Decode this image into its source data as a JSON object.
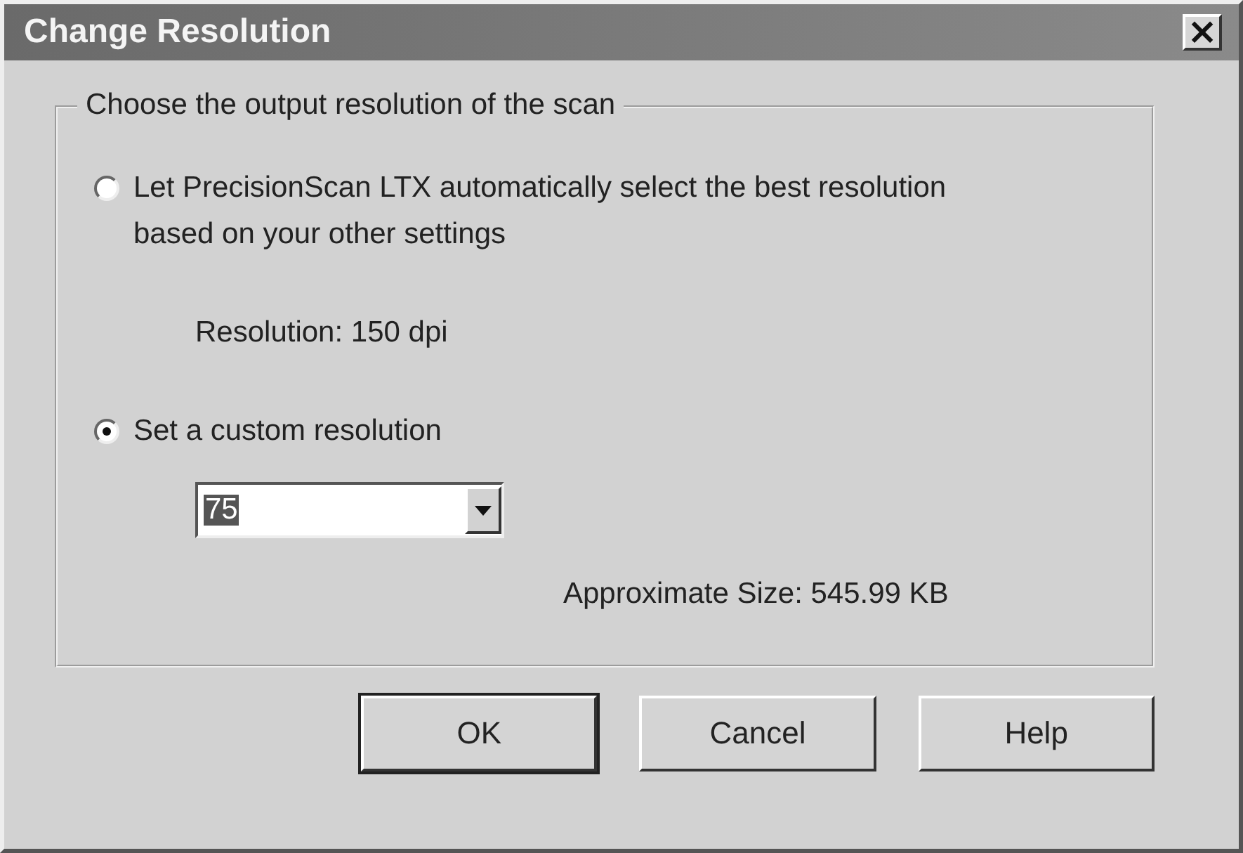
{
  "window": {
    "title": "Change Resolution",
    "close_label": "×"
  },
  "group": {
    "title": "Choose the output resolution of the scan"
  },
  "options": [
    {
      "kind": "auto",
      "label": "Let PrecisionScan LTX automatically select the best resolution based on your other settings",
      "selected": false,
      "detail": "Resolution: 150 dpi"
    },
    {
      "kind": "custom",
      "label": "Set a custom resolution",
      "selected": true,
      "dropdown": {
        "value": "75"
      }
    }
  ],
  "size_text": "Approximate Size: 545.99 KB",
  "buttons": [
    {
      "label": "OK",
      "default": true
    },
    {
      "label": "Cancel",
      "default": false
    },
    {
      "label": "Help",
      "default": false
    }
  ]
}
